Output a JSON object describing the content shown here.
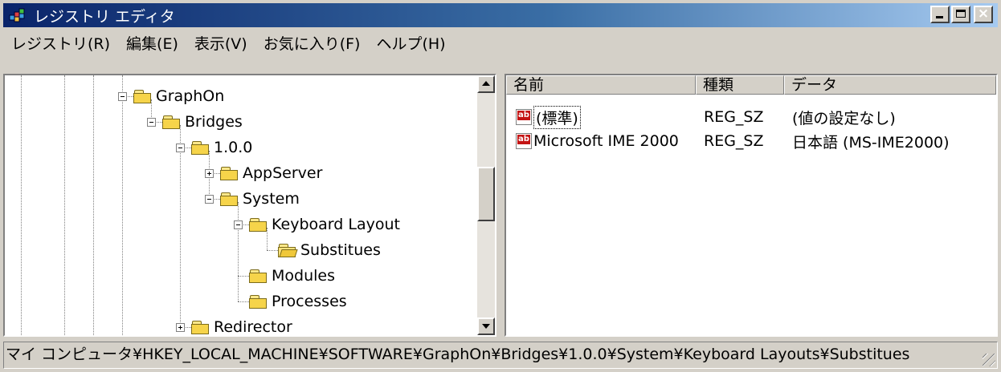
{
  "window": {
    "title": "レジストリ エディタ",
    "icon": "registry-editor-icon"
  },
  "menu": [
    "レジストリ(R)",
    "編集(E)",
    "表示(V)",
    "お気に入り(F)",
    "ヘルプ(H)"
  ],
  "tree": {
    "nodes": [
      {
        "label": "GraphOn",
        "expander": "minus",
        "folder": "closed",
        "depth": 0
      },
      {
        "label": "Bridges",
        "expander": "minus",
        "folder": "closed",
        "depth": 1
      },
      {
        "label": "1.0.0",
        "expander": "minus",
        "folder": "closed",
        "depth": 2
      },
      {
        "label": "AppServer",
        "expander": "plus",
        "folder": "closed",
        "depth": 3
      },
      {
        "label": "System",
        "expander": "minus",
        "folder": "closed",
        "depth": 3
      },
      {
        "label": "Keyboard Layout",
        "expander": "minus",
        "folder": "closed",
        "depth": 4
      },
      {
        "label": "Substitues",
        "expander": "none",
        "folder": "open",
        "depth": 5
      },
      {
        "label": "Modules",
        "expander": "none",
        "folder": "closed",
        "depth": 4
      },
      {
        "label": "Processes",
        "expander": "none",
        "folder": "closed",
        "depth": 4
      },
      {
        "label": "Redirector",
        "expander": "plus",
        "folder": "closed",
        "depth": 2
      }
    ]
  },
  "list": {
    "columns": [
      "名前",
      "種類",
      "データ"
    ],
    "rows": [
      {
        "name": "(標準)",
        "type": "REG_SZ",
        "data": "(値の設定なし)",
        "icon": "reg-sz-icon",
        "focused": true
      },
      {
        "name": "Microsoft IME 2000",
        "type": "REG_SZ",
        "data": "日本語 (MS-IME2000)",
        "icon": "reg-sz-icon",
        "focused": false
      }
    ]
  },
  "status": "マイ コンピュータ¥HKEY_LOCAL_MACHINE¥SOFTWARE¥GraphOn¥Bridges¥1.0.0¥System¥Keyboard Layouts¥Substitues"
}
